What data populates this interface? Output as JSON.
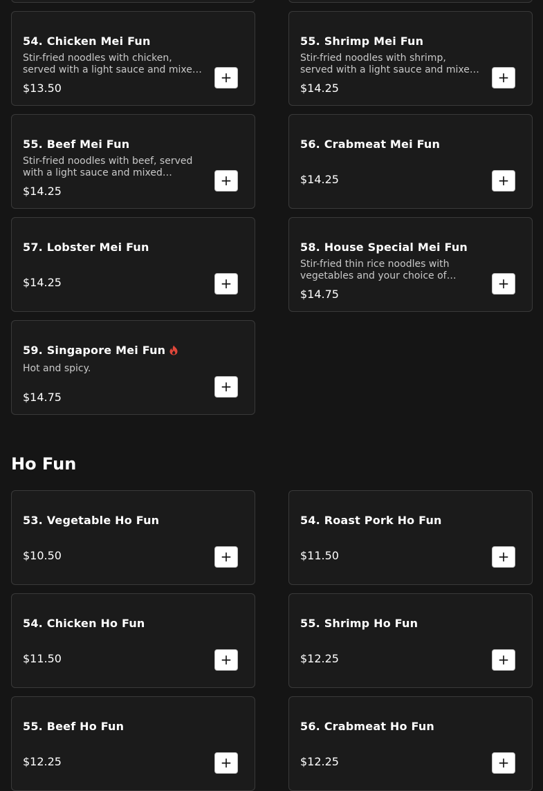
{
  "sections": {
    "mei_fun": {
      "items": [
        {
          "name": "54. Chicken Mei Fun",
          "description": "Stir-fried noodles with chicken, served with a light sauce and mixed vegetables.",
          "price": "$13.50"
        },
        {
          "name": "55. Shrimp Mei Fun",
          "description": "Stir-fried noodles with shrimp, served with a light sauce and mixed vegetables.",
          "price": "$14.25"
        },
        {
          "name": "55. Beef Mei Fun",
          "description": "Stir-fried noodles with beef, served with a light sauce and mixed vegetables.",
          "price": "$14.25"
        },
        {
          "name": "56. Crabmeat Mei Fun",
          "description": "",
          "price": "$14.25"
        },
        {
          "name": "57. Lobster Mei Fun",
          "description": "",
          "price": "$14.25"
        },
        {
          "name": "58. House Special Mei Fun",
          "description": "Stir-fried thin rice noodles with vegetables and your choice of protein.",
          "price": "$14.75"
        },
        {
          "name": "59. Singapore Mei Fun",
          "description": "Hot and spicy.",
          "price": "$14.75",
          "spicy": true
        }
      ]
    },
    "ho_fun": {
      "title": "Ho Fun",
      "items": [
        {
          "name": "53. Vegetable Ho Fun",
          "description": "",
          "price": "$10.50"
        },
        {
          "name": "54. Roast Pork Ho Fun",
          "description": "",
          "price": "$11.50"
        },
        {
          "name": "54. Chicken Ho Fun",
          "description": "",
          "price": "$11.50"
        },
        {
          "name": "55. Shrimp Ho Fun",
          "description": "",
          "price": "$12.25"
        },
        {
          "name": "55. Beef Ho Fun",
          "description": "",
          "price": "$12.25"
        },
        {
          "name": "56. Crabmeat Ho Fun",
          "description": "",
          "price": "$12.25"
        }
      ]
    }
  },
  "add_button_label": "+",
  "icons": {
    "spicy": "flame-icon",
    "add": "plus-icon"
  },
  "colors": {
    "background": "#151515",
    "card": "#1b1b1b",
    "spicy": "#e0473a"
  }
}
